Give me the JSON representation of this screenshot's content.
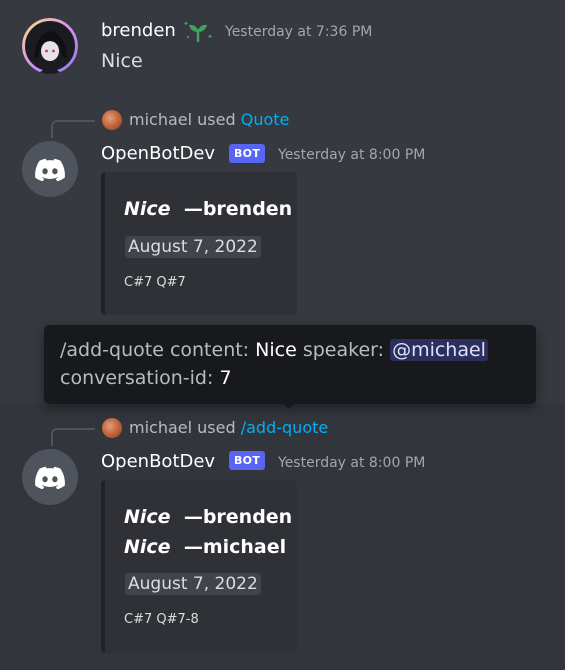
{
  "message1": {
    "username": "brenden",
    "badge_icon": "sprout-icon",
    "timestamp": "Yesterday at 7:36 PM",
    "content": "Nice"
  },
  "message2": {
    "reply_user": "michael",
    "reply_used": "used",
    "reply_command": "Quote",
    "username": "OpenBotDev",
    "bot_tag": "BOT",
    "timestamp": "Yesterday at 8:00 PM",
    "embed": {
      "quote": "Nice",
      "author": "—brenden",
      "date": "August 7, 2022",
      "footer": "C#7 Q#7"
    }
  },
  "tooltip": {
    "command": "/add-quote",
    "content_label": "content:",
    "content_value": "Nice",
    "speaker_label": "speaker:",
    "speaker_value": "@michael",
    "conv_label": "conversation-id:",
    "conv_value": "7"
  },
  "message3": {
    "reply_user": "michael",
    "reply_used": "used",
    "reply_command": "/add-quote",
    "username": "OpenBotDev",
    "bot_tag": "BOT",
    "timestamp": "Yesterday at 8:00 PM",
    "embed": {
      "quote1": "Nice",
      "author1": "—brenden",
      "quote2": "Nice",
      "author2": "—michael",
      "date": "August 7, 2022",
      "footer": "C#7 Q#7-8"
    }
  },
  "colors": {
    "background": "#36393f",
    "bot_tag": "#5865f2",
    "link": "#00aff4",
    "embed_bg": "#2f3136",
    "tooltip_bg": "#18191c"
  }
}
